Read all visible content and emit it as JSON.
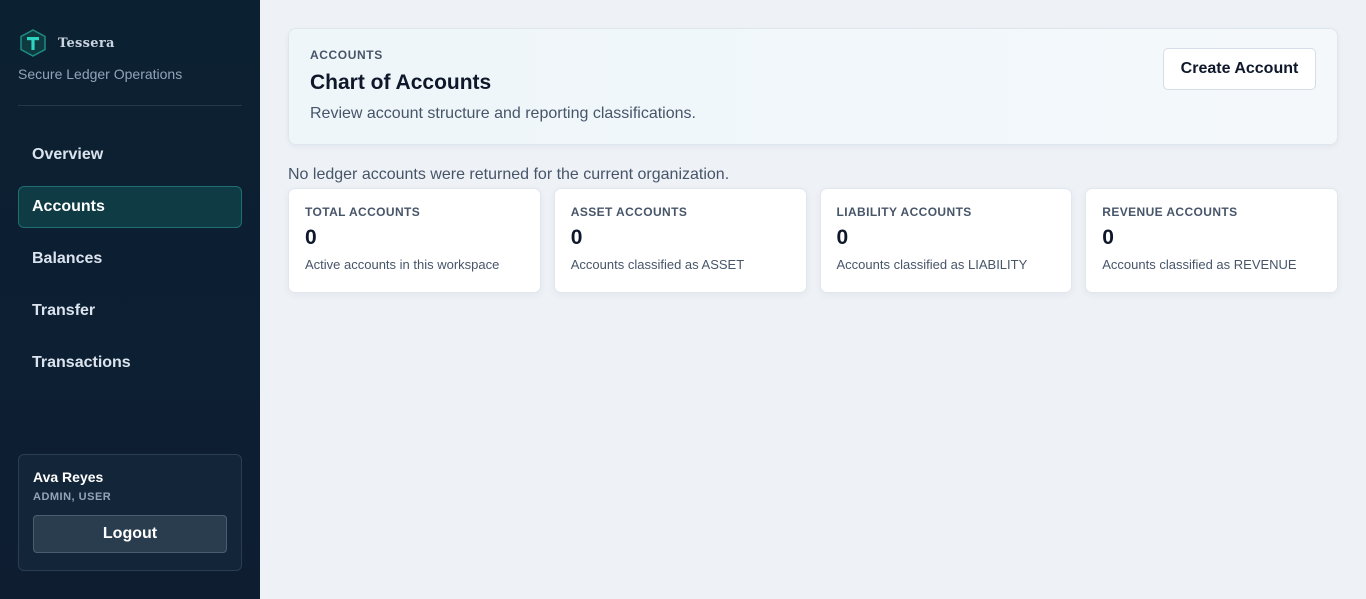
{
  "brand": {
    "name": "Tessera",
    "tagline": "Secure Ledger Operations",
    "logo_icon": "tessera-t-logo-icon"
  },
  "nav": {
    "items": [
      {
        "label": "Overview",
        "active": false
      },
      {
        "label": "Accounts",
        "active": true
      },
      {
        "label": "Balances",
        "active": false
      },
      {
        "label": "Transfer",
        "active": false
      },
      {
        "label": "Transactions",
        "active": false
      }
    ]
  },
  "user": {
    "name": "Ava Reyes",
    "roles": "ADMIN, USER",
    "logout_label": "Logout"
  },
  "header": {
    "eyebrow": "ACCOUNTS",
    "title": "Chart of Accounts",
    "subtitle": "Review account structure and reporting classifications.",
    "create_label": "Create Account"
  },
  "empty_message": "No ledger accounts were returned for the current organization.",
  "stats": [
    {
      "label": "TOTAL ACCOUNTS",
      "value": "0",
      "desc": "Active accounts in this workspace"
    },
    {
      "label": "ASSET ACCOUNTS",
      "value": "0",
      "desc": "Accounts classified as ASSET"
    },
    {
      "label": "LIABILITY ACCOUNTS",
      "value": "0",
      "desc": "Accounts classified as LIABILITY"
    },
    {
      "label": "REVENUE ACCOUNTS",
      "value": "0",
      "desc": "Accounts classified as REVENUE"
    }
  ],
  "colors": {
    "sidebar_bg": "#0d1f33",
    "accent": "#1f6e70",
    "active_nav_bg": "#0f3b45",
    "page_bg": "#eef2f7"
  }
}
